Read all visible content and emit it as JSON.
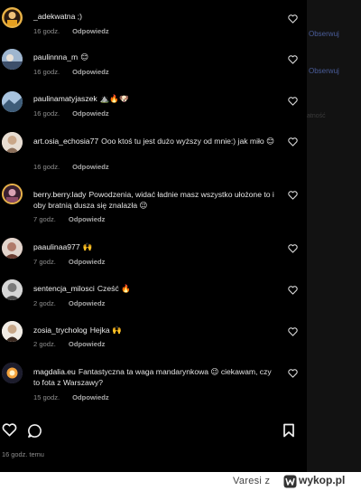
{
  "comments": [
    {
      "username": "_adekwatna ;)",
      "text": "",
      "time": "16 godz.",
      "reply": "Odpowiedz",
      "avatar_color": "#e6a020",
      "ring": true
    },
    {
      "username": "paulinnna_m",
      "text": "😊",
      "time": "16 godz.",
      "reply": "Odpowiedz",
      "avatar_color": "#6f86a8",
      "ring": false
    },
    {
      "username": "paulinamatyjaszek",
      "text": "⛰️🔥🐶",
      "time": "16 godz.",
      "reply": "Odpowiedz",
      "avatar_color": "#7fa3c6",
      "ring": false
    },
    {
      "username": "art.osia_echosia77",
      "text": "Ooo ktoś tu jest dużo wyższy od mnie:) jak miło 😊",
      "time": "16 godz.",
      "reply": "Odpowiedz",
      "avatar_color": "#d8c9b8",
      "ring": false
    },
    {
      "username": "berry.berry.lady",
      "text": "Powodzenia, widać ładnie masz wszystko ułożone to i oby bratnią dusza się znalazła 😉",
      "time": "7 godz.",
      "reply": "Odpowiedz",
      "avatar_color": "#8a4a66",
      "ring": true
    },
    {
      "username": "paaulinaa977",
      "text": "🙌",
      "time": "7 godz.",
      "reply": "Odpowiedz",
      "avatar_color": "#b07a6a",
      "ring": false
    },
    {
      "username": "sentencja_milosci",
      "text": "Cześć 🔥",
      "time": "2 godz.",
      "reply": "Odpowiedz",
      "avatar_color": "#bfbfbf",
      "ring": false
    },
    {
      "username": "zosia_trycholog",
      "text": "Hejka 🙌",
      "time": "2 godz.",
      "reply": "Odpowiedz",
      "avatar_color": "#e9e4dc",
      "ring": false
    },
    {
      "username": "magdalia.eu",
      "text": "Fantastyczna ta waga mandarynkowa 😉 ciekawam, czy to fota z Warszawy?",
      "time": "15 godz.",
      "reply": "Odpowiedz",
      "avatar_color": "#5a5a78",
      "ring": false
    }
  ],
  "side": {
    "follow_1": "Obserwuj",
    "follow_2": "Obserwuj",
    "muted": "atność"
  },
  "post": {
    "posted_ago": "16 godz. temu"
  },
  "footer": {
    "user": "Varesi z",
    "site": "wykop.pl"
  },
  "colors": {
    "background": "#000000",
    "text": "#e6e6e6",
    "muted": "#8e8e8e",
    "link": "#4a5d9a"
  },
  "icons": [
    "heart-icon",
    "comment-icon",
    "bookmark-icon",
    "wykop-logo-icon"
  ]
}
